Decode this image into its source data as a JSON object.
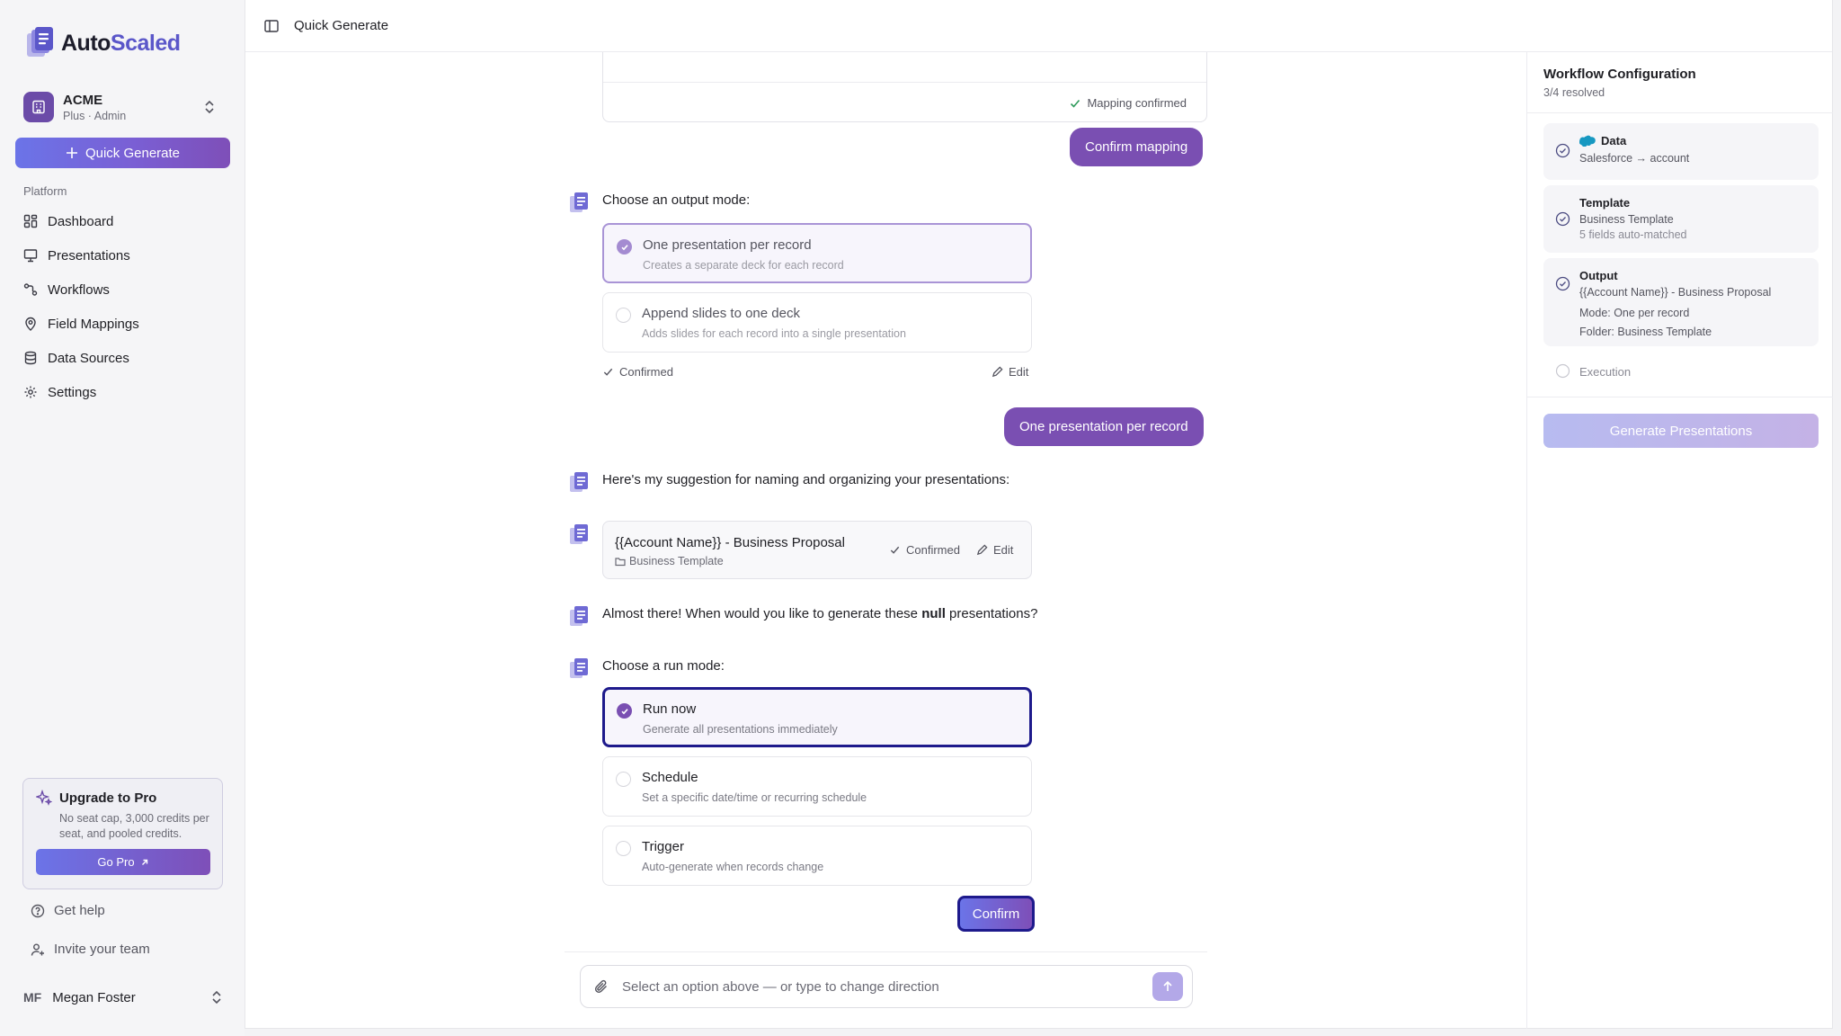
{
  "app": {
    "brand_part1": "Auto",
    "brand_part2": "Scaled"
  },
  "org": {
    "name": "ACME",
    "plan": "Plus · Admin"
  },
  "sidebar": {
    "quick_generate_label": "Quick Generate",
    "platform_heading": "Platform",
    "nav": [
      {
        "label": "Dashboard",
        "icon": "grid-icon"
      },
      {
        "label": "Presentations",
        "icon": "presentation-icon"
      },
      {
        "label": "Workflows",
        "icon": "workflow-icon"
      },
      {
        "label": "Field Mappings",
        "icon": "map-pin-icon"
      },
      {
        "label": "Data Sources",
        "icon": "database-icon"
      },
      {
        "label": "Settings",
        "icon": "gear-icon"
      }
    ],
    "upgrade": {
      "title": "Upgrade to Pro",
      "text": "No seat cap, 3,000 credits per seat, and pooled credits.",
      "button": "Go Pro"
    },
    "help_label": "Get help",
    "invite_label": "Invite your team",
    "user": {
      "initials": "MF",
      "name": "Megan Foster"
    }
  },
  "topbar": {
    "title": "Quick Generate"
  },
  "chat": {
    "mapping_confirmed": "Mapping confirmed",
    "confirm_mapping_bubble": "Confirm mapping",
    "output_prompt": "Choose an output mode:",
    "output_options": [
      {
        "title": "One presentation per record",
        "desc": "Creates a separate deck for each record"
      },
      {
        "title": "Append slides to one deck",
        "desc": "Adds slides for each record into a single presentation"
      }
    ],
    "output_confirmed": "Confirmed",
    "output_edit": "Edit",
    "output_bubble": "One presentation per record",
    "naming_prompt": "Here's my suggestion for naming and organizing your presentations:",
    "naming_card": {
      "title": "{{Account Name}} - Business Proposal",
      "folder": "Business Template",
      "confirmed": "Confirmed",
      "edit": "Edit"
    },
    "when_prompt_before": "Almost there! When would you like to generate these ",
    "when_prompt_bold": "null",
    "when_prompt_after": " presentations?",
    "run_prompt": "Choose a run mode:",
    "run_options": [
      {
        "title": "Run now",
        "desc": "Generate all presentations immediately"
      },
      {
        "title": "Schedule",
        "desc": "Set a specific date/time or recurring schedule"
      },
      {
        "title": "Trigger",
        "desc": "Auto-generate when records change"
      }
    ],
    "confirm_label": "Confirm",
    "composer_placeholder": "Select an option above — or type to change direction"
  },
  "panel": {
    "title": "Workflow Configuration",
    "subtitle": "3/4 resolved",
    "steps": {
      "data": {
        "title": "Data",
        "line1": "Salesforce → account"
      },
      "template": {
        "title": "Template",
        "line1": "Business Template",
        "line2": "5 fields auto-matched"
      },
      "output": {
        "title": "Output",
        "line1": "{{Account Name}} - Business Proposal",
        "line2": "Mode: One per record",
        "line3": "Folder: Business Template"
      },
      "execution": {
        "title": "Execution"
      }
    },
    "generate_label": "Generate Presentations"
  },
  "colors": {
    "accent": "#7a4fb2",
    "focus_ring": "#1e1a8c",
    "brand_blue": "#5b57c9",
    "salesforce": "#1798c1"
  }
}
